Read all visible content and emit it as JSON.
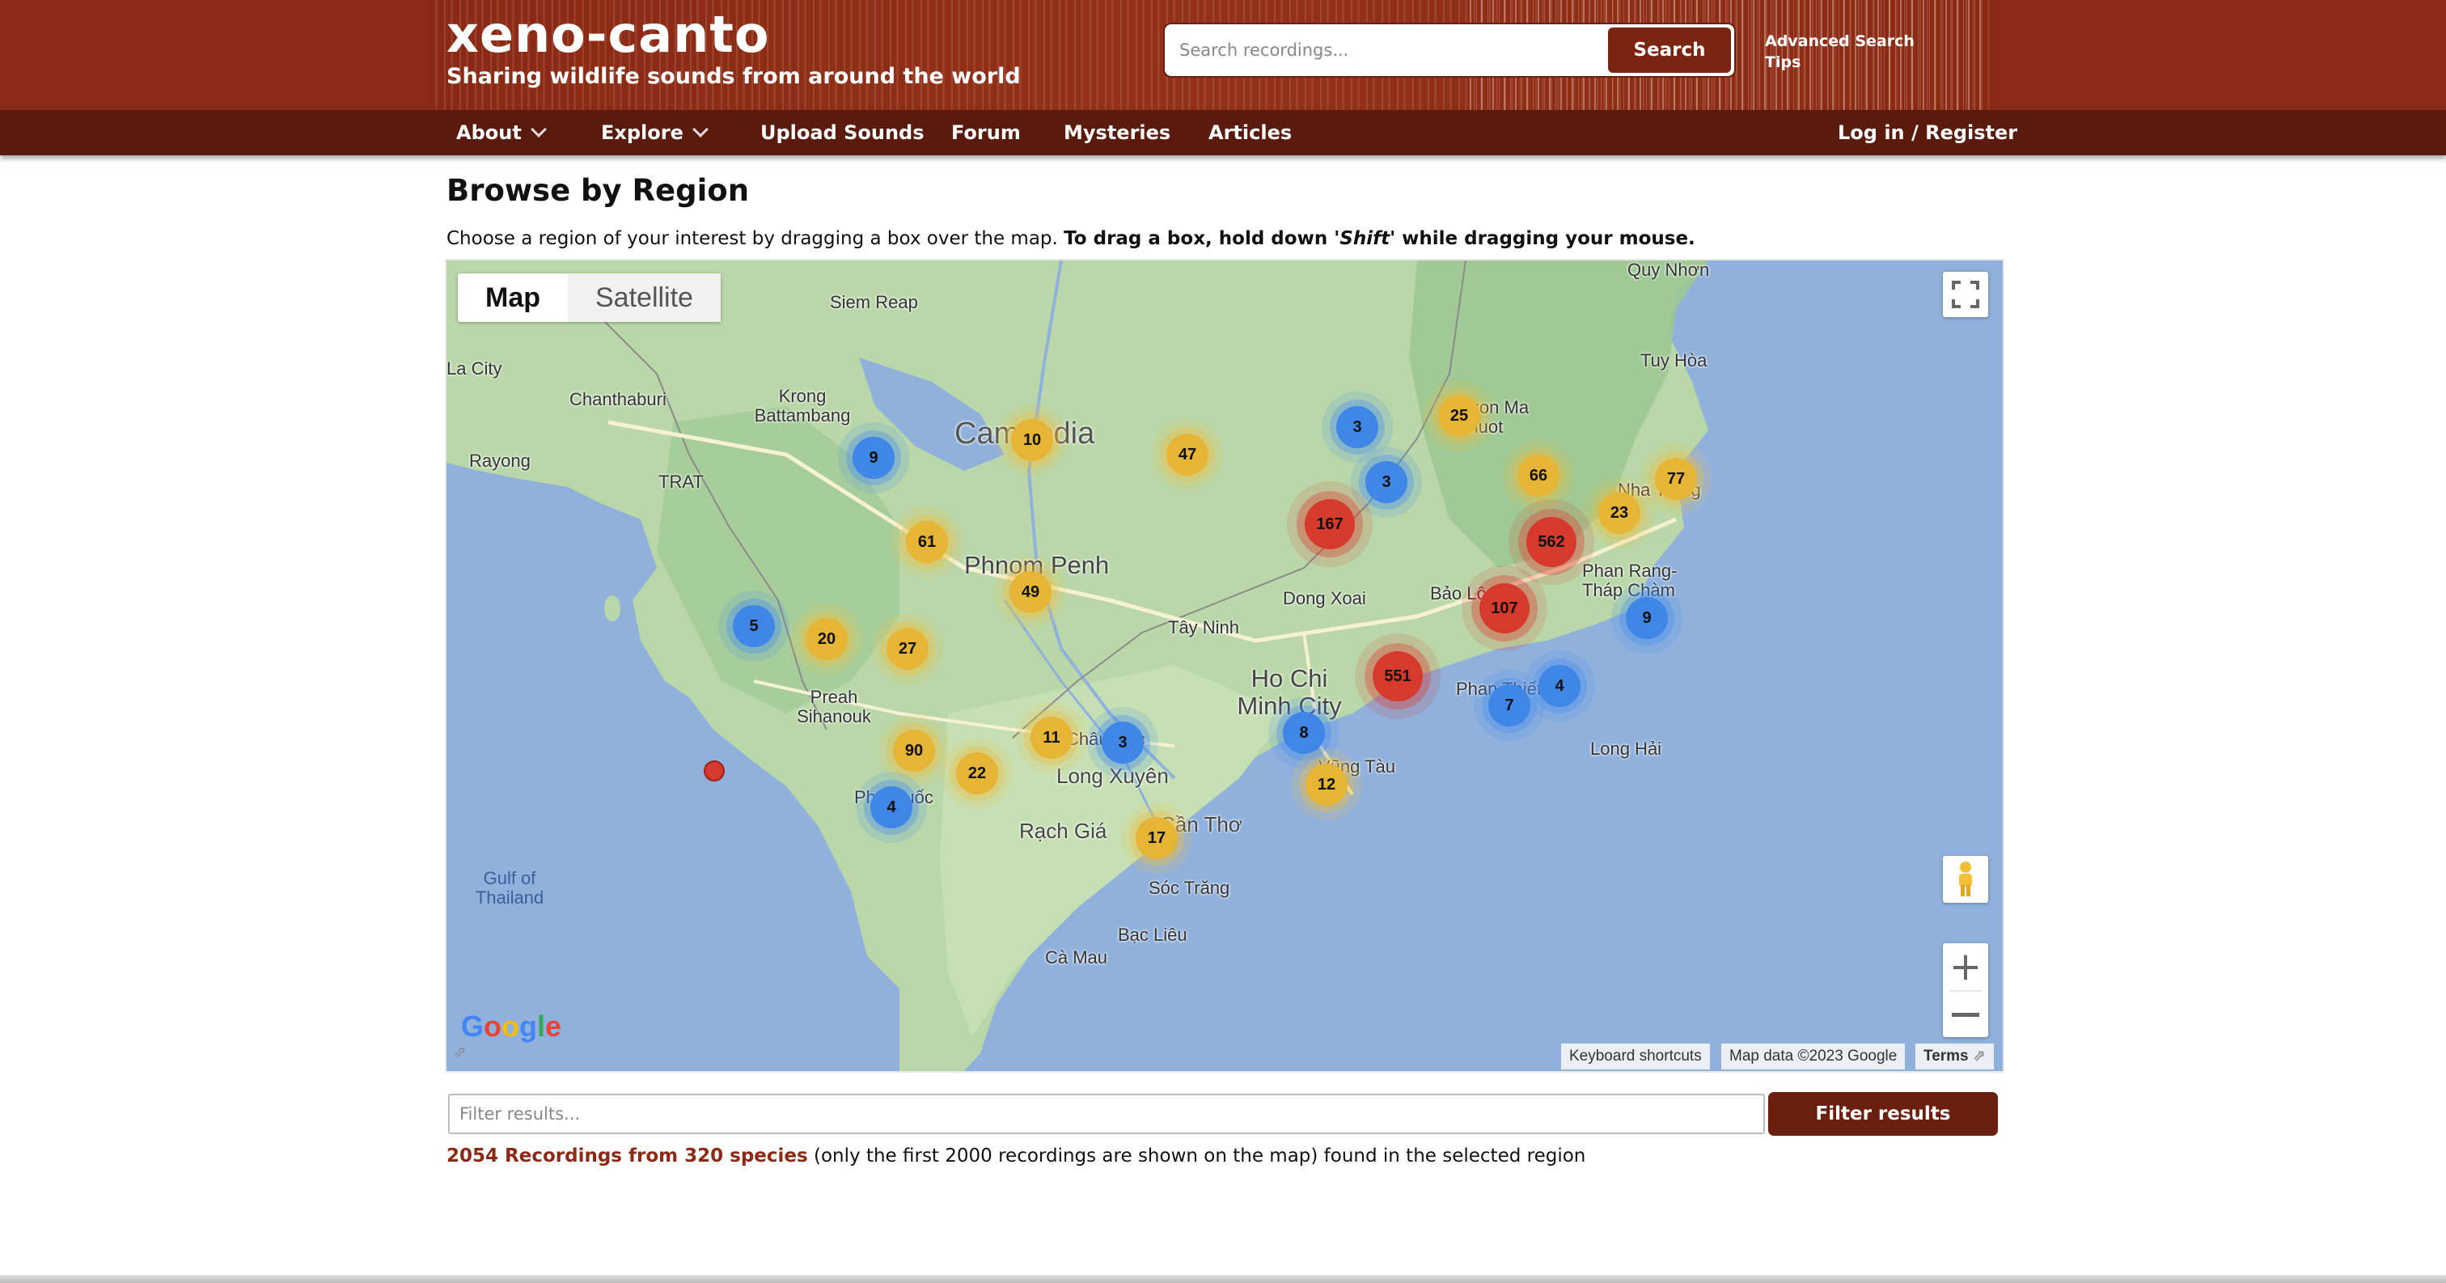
{
  "header": {
    "site_name": "xeno-canto",
    "tagline": "Sharing wildlife sounds from around the world",
    "search_placeholder": "Search recordings...",
    "search_button": "Search",
    "advanced_search": "Advanced Search",
    "tips": "Tips"
  },
  "nav": {
    "about": "About",
    "explore": "Explore",
    "upload": "Upload Sounds",
    "forum": "Forum",
    "mysteries": "Mysteries",
    "articles": "Articles",
    "login": "Log in / Register"
  },
  "page": {
    "title": "Browse by Region",
    "instructions_plain": "Choose a region of your interest by dragging a box over the map. ",
    "instructions_bold_1": "To drag a box, hold down '",
    "instructions_shift": "Shift",
    "instructions_bold_2": "' while dragging your mouse."
  },
  "map": {
    "type_map": "Map",
    "type_satellite": "Satellite",
    "google_logo": "Google",
    "keyboard_shortcuts": "Keyboard shortcuts",
    "map_data": "Map data ©2023 Google",
    "terms": "Terms",
    "labels": {
      "cambodia": "Cambodia",
      "phnom_penh": "Phnom Penh",
      "ho_chi_minh": "Ho Chi Minh City",
      "siem_reap": "Siem Reap",
      "krong_battambang": "Krong Battambang",
      "chanthaburi": "Chanthaburi",
      "rayong": "Rayong",
      "trat": "TRAT",
      "preah_sihanouk": "Preah Sihanouk",
      "long_xuyen": "Long Xuyên",
      "rach_gia": "Rạch Giá",
      "can_tho": "Cần Thơ",
      "soc_trang": "Sóc Trăng",
      "bac_lieu": "Bạc Liêu",
      "ca_mau": "Cà Mau",
      "gulf_of_thailand": "Gulf of Thailand",
      "tay_ninh": "Tây Ninh",
      "dong_xoai": "Dong Xoai",
      "bao_loc": "Bảo Lộc",
      "vung_tau": "Vũng Tàu",
      "long_hai": "Long Hải",
      "phan_rang": "Phan Rang-Tháp Chàm",
      "phan_thiet": "Phan Thiết",
      "tuy_hoa": "Tuy Hòa",
      "quy_nhon": "Quy Nhơn",
      "buon_ma_thuot": "Buon Ma Thuot",
      "nha_trang": "Nha Trang",
      "phu_quoc": "Phú Quốc",
      "chau_doc": "Châu Đốc",
      "la_city": "La City"
    },
    "clusters": [
      {
        "count": "9",
        "color": "blue"
      },
      {
        "count": "10",
        "color": "yellow"
      },
      {
        "count": "47",
        "color": "yellow"
      },
      {
        "count": "3",
        "color": "blue"
      },
      {
        "count": "25",
        "color": "yellow"
      },
      {
        "count": "3",
        "color": "blue"
      },
      {
        "count": "66",
        "color": "yellow"
      },
      {
        "count": "77",
        "color": "yellow"
      },
      {
        "count": "23",
        "color": "yellow"
      },
      {
        "count": "167",
        "color": "red"
      },
      {
        "count": "562",
        "color": "red"
      },
      {
        "count": "61",
        "color": "yellow"
      },
      {
        "count": "49",
        "color": "yellow"
      },
      {
        "count": "107",
        "color": "red"
      },
      {
        "count": "9",
        "color": "blue"
      },
      {
        "count": "5",
        "color": "blue"
      },
      {
        "count": "20",
        "color": "yellow"
      },
      {
        "count": "27",
        "color": "yellow"
      },
      {
        "count": "551",
        "color": "red"
      },
      {
        "count": "4",
        "color": "blue"
      },
      {
        "count": "7",
        "color": "blue"
      },
      {
        "count": "11",
        "color": "yellow"
      },
      {
        "count": "3",
        "color": "blue"
      },
      {
        "count": "8",
        "color": "blue"
      },
      {
        "count": "90",
        "color": "yellow"
      },
      {
        "count": "22",
        "color": "yellow"
      },
      {
        "count": "12",
        "color": "yellow"
      },
      {
        "count": "4",
        "color": "blue"
      },
      {
        "count": "17",
        "color": "yellow"
      }
    ]
  },
  "filter": {
    "placeholder": "Filter results...",
    "button": "Filter results"
  },
  "results": {
    "highlight": "2054 Recordings from 320 species",
    "rest": " (only the first 2000 recordings are shown on the map) found in the selected region"
  },
  "colors": {
    "brand": "#8b2b16",
    "nav": "#5a1a0c",
    "sea": "#8fb1dc",
    "land": "#b9d7a8"
  }
}
